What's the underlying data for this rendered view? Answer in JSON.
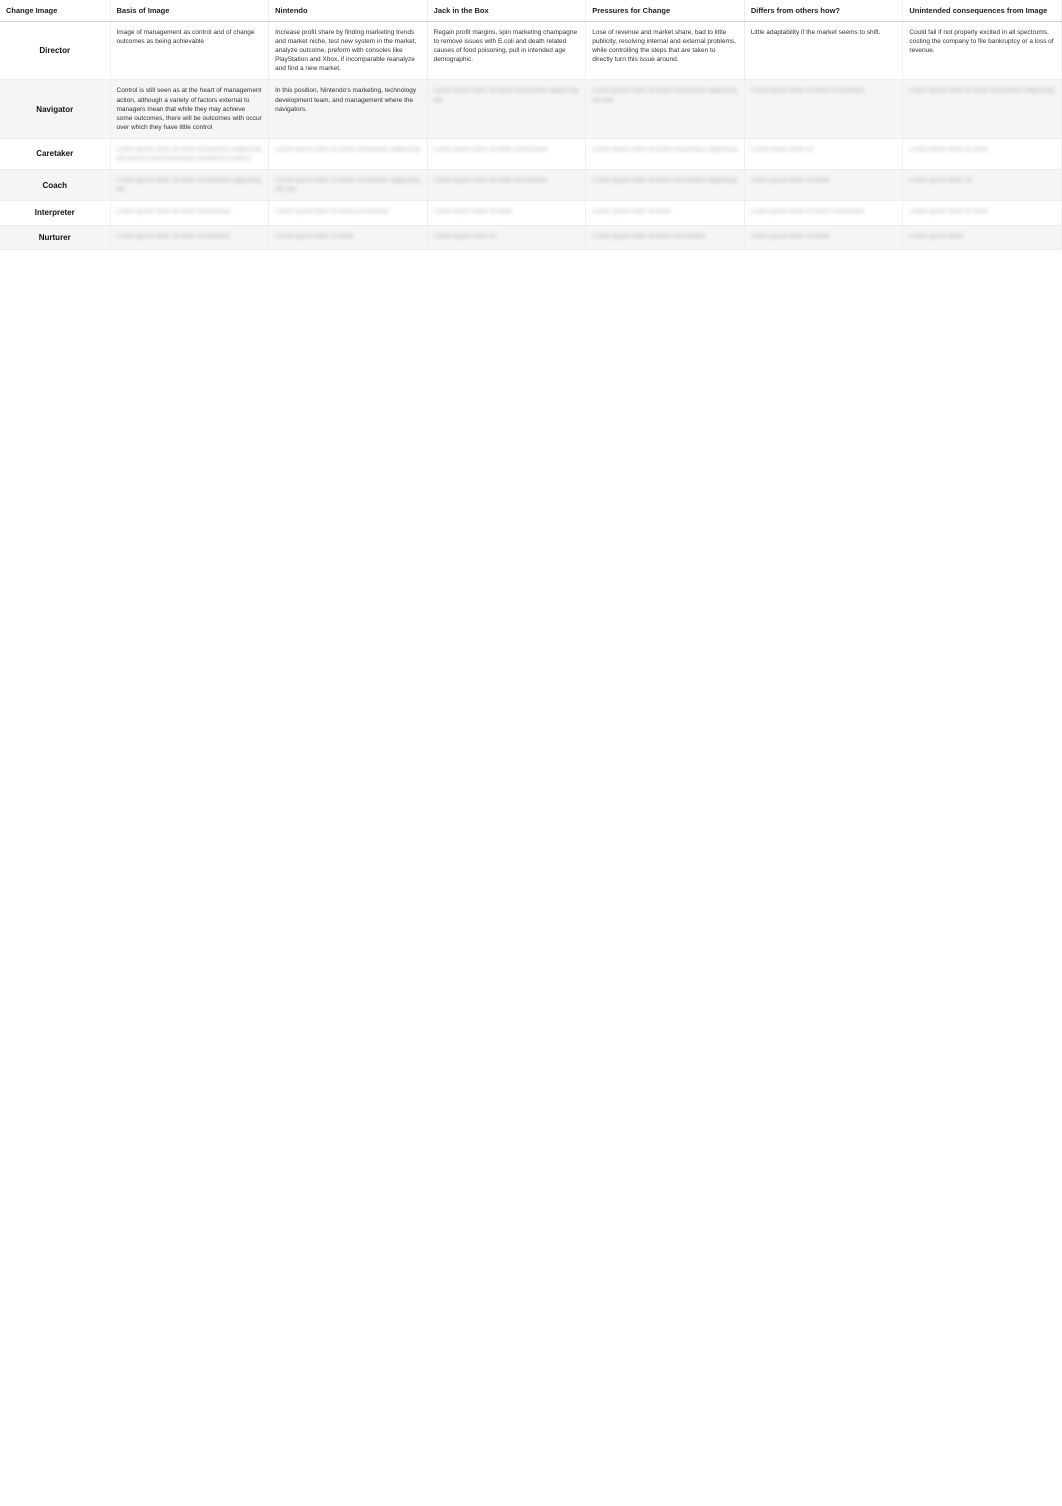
{
  "table": {
    "headers": [
      "Change Image",
      "Basis of Image",
      "Nintendo",
      "Jack in the Box",
      "Pressures for Change",
      "Differs from others how?",
      "Unintended consequences from Image"
    ],
    "rows": [
      {
        "role": "Director",
        "basis": "Image of management as control and of change outcomes as being achievable",
        "nintendo": "Increase profit share by finding marketing trends and market niche, test new system in the market, analyze outcome, preform with consoles like PlayStation and Xbox, if incomparable reanalyze and find a new market.",
        "jack": "Regain profit margins, spin marketing champagne to remove issues with E.coli and death related causes of food poisoning, pull in intended age demographic.",
        "pressures": "Lose of revenue and market share, bad to little publicity, resolving internal and external problems, while controlling the steps that are taken to directly turn this issue around.",
        "differs": "Little adaptability if the market seems to shift.",
        "unintended": "Could fail if not properly excited in all spectrums, costing the company to file bankruptcy or a loss of revenue.",
        "blurred": false
      },
      {
        "role": "Navigator",
        "basis": "Control is still seen as at the heart of management action, although a variety of factors external to managers mean that while they may achieve some outcomes, there will be outcomes with occur over which they have little control",
        "nintendo": "In this position, Nintendo's marketing, technology development team, and management where the navigators.",
        "jack": "blurred",
        "pressures": "blurred",
        "differs": "blurred",
        "unintended": "blurred",
        "blurred": false,
        "partial_blur": true
      },
      {
        "role": "Caretaker",
        "basis": "blurred",
        "nintendo": "blurred",
        "jack": "blurred",
        "pressures": "blurred",
        "differs": "blurred",
        "unintended": "blurred",
        "blurred": true
      },
      {
        "role": "Coach",
        "basis": "blurred",
        "nintendo": "blurred",
        "jack": "blurred",
        "pressures": "blurred",
        "differs": "blurred",
        "unintended": "blurred",
        "blurred": true
      },
      {
        "role": "Interpreter",
        "basis": "blurred",
        "nintendo": "blurred",
        "jack": "blurred",
        "pressures": "blurred",
        "differs": "blurred",
        "unintended": "blurred",
        "blurred": true
      },
      {
        "role": "Nurturer",
        "basis": "blurred",
        "nintendo": "blurred",
        "jack": "blurred",
        "pressures": "blurred",
        "differs": "blurred",
        "unintended": "blurred",
        "blurred": true
      }
    ],
    "blurred_text": {
      "caretaker_basis": "Lorem ipsum dolor sit amet consectetur adipiscing elit sed do eiusmod tempor incididunt ut labore",
      "caretaker_nintendo": "Lorem ipsum dolor sit amet consectetur adipiscing",
      "caretaker_jack": "Lorem ipsum dolor sit amet consectetur",
      "caretaker_pressures": "Lorem ipsum dolor sit amet consectetur adipiscing",
      "caretaker_differs": "Lorem ipsum dolor sit",
      "caretaker_unintended": "Lorem ipsum dolor sit amet",
      "coach_basis": "Lorem ipsum dolor sit amet consectetur adipiscing elit",
      "coach_nintendo": "Lorem ipsum dolor sit amet consectetur adipiscing elit sed",
      "coach_jack": "Lorem ipsum dolor sit amet consectetur",
      "coach_pressures": "Lorem ipsum dolor sit amet consectetur adipiscing",
      "coach_differs": "Lorem ipsum dolor sit amet",
      "coach_unintended": "Lorem ipsum dolor sit",
      "interp_basis": "Lorem ipsum dolor sit amet consectetur",
      "interp_nintendo": "Lorem ipsum dolor sit amet consectetur",
      "interp_jack": "Lorem ipsum dolor sit amet",
      "interp_pressures": "Lorem ipsum dolor sit amet",
      "interp_differs": "Lorem ipsum dolor sit amet consectetur",
      "interp_unintended": "Lorem ipsum dolor sit amet",
      "nurt_basis": "Lorem ipsum dolor sit amet consectetur",
      "nurt_nintendo": "Lorem ipsum dolor sit amet",
      "nurt_jack": "Lorem ipsum dolor sit",
      "nurt_pressures": "Lorem ipsum dolor sit amet consectetur",
      "nurt_differs": "Lorem ipsum dolor sit amet",
      "nurt_unintended": "Lorem ipsum dolor",
      "nav_jack": "Lorem ipsum dolor sit amet consectetur adipiscing elit",
      "nav_pressures": "Lorem ipsum dolor sit amet consectetur adipiscing elit sed",
      "nav_differs": "Lorem ipsum dolor sit amet consectetur",
      "nav_unintended": "Lorem ipsum dolor sit amet consectetur adipiscing"
    }
  }
}
